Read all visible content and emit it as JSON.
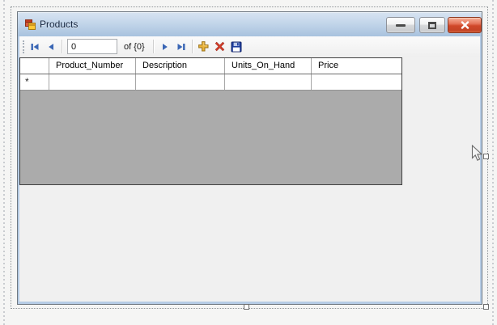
{
  "window": {
    "title": "Products",
    "controls": {
      "minimize": "minimize",
      "maximize": "maximize",
      "close": "close"
    }
  },
  "navigator": {
    "move_first": "move-first",
    "move_previous": "move-previous",
    "position_value": "0",
    "count_label": "of {0}",
    "move_next": "move-next",
    "move_last": "move-last",
    "add_new": "add-new",
    "delete": "delete",
    "save": "save-data"
  },
  "grid": {
    "columns": [
      "Product_Number",
      "Description",
      "Units_On_Hand",
      "Price"
    ],
    "new_row_marker": "*",
    "rows": []
  },
  "designer": {
    "selected_control": "form",
    "handles": [
      "right-center",
      "bottom-center",
      "bottom-right"
    ]
  },
  "colors": {
    "titlebar_top": "#D8E4F2",
    "titlebar_bottom": "#A8C2DE",
    "window_frame": "#B6CCE5",
    "client_bg": "#F0F0F0",
    "grid_empty_bg": "#ABABAB",
    "nav_blue": "#3A66B5",
    "add_gold": "#E9B33C",
    "delete_red": "#D6402C",
    "save_blue": "#1E3E9E",
    "close_button_red": "#D0482A"
  }
}
